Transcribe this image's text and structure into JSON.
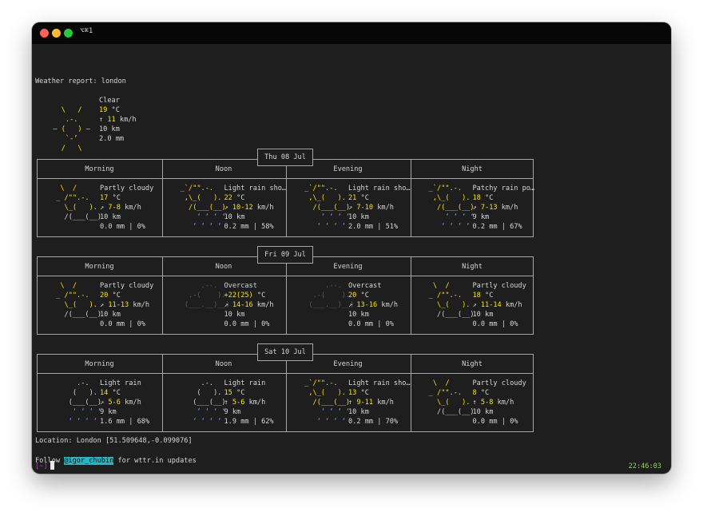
{
  "window": {
    "title": "⌥⌘1"
  },
  "report": {
    "header": "Weather report: london",
    "current": {
      "icon": [
        "    \\   /    ",
        "     .-.     ",
        "  ― (   ) ―  ",
        "     `-’     ",
        "    /   \\    "
      ],
      "condition": "Clear",
      "temp": "19",
      "temp_unit": " °C",
      "wind_arrow": "↑",
      "wind": " 11",
      "wind_unit": " km/h",
      "visibility": "10 km",
      "precip": "2.0 mm"
    },
    "columns": [
      "Morning",
      "Noon",
      "Evening",
      "Night"
    ],
    "days": [
      {
        "date": "Thu 08 Jul",
        "periods": [
          {
            "condition": "Partly cloudy",
            "temp": "17",
            "temp_unit": " °C",
            "wind_arrow": "↗",
            "wind": " 7-8",
            "wind_unit": " km/h",
            "visibility": "10 km",
            "precip": "0.0 mm | 0%",
            "icon_type": "partly"
          },
          {
            "condition": "Light rain sho…",
            "temp": "22",
            "temp_unit": " °C",
            "wind_arrow": "↗",
            "wind": " 10-12",
            "wind_unit": " km/h",
            "visibility": "10 km",
            "precip": "0.2 mm | 58%",
            "icon_type": "sunrain"
          },
          {
            "condition": "Light rain sho…",
            "temp": "21",
            "temp_unit": " °C",
            "wind_arrow": "↗",
            "wind": " 7-10",
            "wind_unit": " km/h",
            "visibility": "10 km",
            "precip": "2.0 mm | 51%",
            "icon_type": "sunrain"
          },
          {
            "condition": "Patchy rain po…",
            "temp": "18",
            "temp_unit": " °C",
            "wind_arrow": "↗",
            "wind": " 7-13",
            "wind_unit": " km/h",
            "visibility": "9 km",
            "precip": "0.2 mm | 67%",
            "icon_type": "sunrain"
          }
        ]
      },
      {
        "date": "Fri 09 Jul",
        "periods": [
          {
            "condition": "Partly cloudy",
            "temp": "20",
            "temp_unit": " °C",
            "wind_arrow": "↗",
            "wind": " 11-13",
            "wind_unit": " km/h",
            "visibility": "10 km",
            "precip": "0.0 mm | 0%",
            "icon_type": "partly"
          },
          {
            "condition": "Overcast",
            "temp": "+22(25)",
            "temp_unit": " °C",
            "wind_arrow": "↗",
            "wind": " 14-16",
            "wind_unit": " km/h",
            "visibility": "10 km",
            "precip": "0.0 mm | 0%",
            "icon_type": "overcast"
          },
          {
            "condition": "Overcast",
            "temp": "20",
            "temp_unit": " °C",
            "wind_arrow": "↗",
            "wind": " 13-16",
            "wind_unit": " km/h",
            "visibility": "10 km",
            "precip": "0.0 mm | 0%",
            "icon_type": "overcast"
          },
          {
            "condition": "Partly cloudy",
            "temp": "18",
            "temp_unit": " °C",
            "wind_arrow": "↗",
            "wind": " 11-14",
            "wind_unit": " km/h",
            "visibility": "10 km",
            "precip": "0.0 mm | 0%",
            "icon_type": "partly"
          }
        ]
      },
      {
        "date": "Sat 10 Jul",
        "periods": [
          {
            "condition": "Light rain",
            "temp": "14",
            "temp_unit": " °C",
            "wind_arrow": "↗",
            "wind": " 5-6",
            "wind_unit": " km/h",
            "visibility": "9 km",
            "precip": "1.6 mm | 68%",
            "icon_type": "rain"
          },
          {
            "condition": "Light rain",
            "temp": "15",
            "temp_unit": " °C",
            "wind_arrow": "↑",
            "wind": " 5-6",
            "wind_unit": " km/h",
            "visibility": "9 km",
            "precip": "1.9 mm | 62%",
            "icon_type": "rain"
          },
          {
            "condition": "Light rain sho…",
            "temp": "13",
            "temp_unit": " °C",
            "wind_arrow": "↑",
            "wind": " 9-11",
            "wind_unit": " km/h",
            "visibility": "10 km",
            "precip": "0.2 mm | 70%",
            "icon_type": "sunrain"
          },
          {
            "condition": "Partly cloudy",
            "temp": "8",
            "temp_unit": " °C",
            "wind_arrow": "↑",
            "wind": " 5-8",
            "wind_unit": " km/h",
            "visibility": "10 km",
            "precip": "0.0 mm | 0%",
            "icon_type": "partly"
          }
        ]
      }
    ],
    "location": "Location: London [51.509648,-0.099076]",
    "follow_prefix": "Follow ",
    "follow_handle": "@igor_chubin",
    "follow_suffix": " for wttr.in updates"
  },
  "icons": {
    "partly": [
      [
        "y",
        "  \\  /"
      ],
      [
        "y",
        " _ /\"\".-.    ",
        "w"
      ],
      [
        "y",
        "   \\_(   ).  ",
        "w"
      ],
      [
        "w",
        "   /(___(__) "
      ]
    ],
    "sunrain": [
      [
        "y",
        " _`/\"\".-.    "
      ],
      [
        "y",
        "  ,\\_(   ).  "
      ],
      [
        "y",
        "   /(___(__) "
      ],
      [
        "b",
        "     ‘ ‘ ‘ ‘  "
      ]
    ],
    "overcast": [
      [
        "dg",
        "      .--.    "
      ],
      [
        "dg",
        "   .-(    ).  "
      ],
      [
        "dg",
        "  (___.__)__) "
      ]
    ],
    "rain": [
      [
        "w",
        "      .-.     "
      ],
      [
        "w",
        "     (   ).   "
      ],
      [
        "w",
        "    (___(__)  "
      ],
      [
        "b",
        "     ‘ ‘ ‘ ‘  "
      ]
    ]
  },
  "statusbar": {
    "prompt": "[~]",
    "clock": "22:46:03"
  },
  "colors": {
    "yellow": "#f7e600",
    "blue": "#7f9cf0",
    "prompt": "#b23fb8",
    "clock": "#8ed84a",
    "handle_bg": "#22b7c5"
  }
}
